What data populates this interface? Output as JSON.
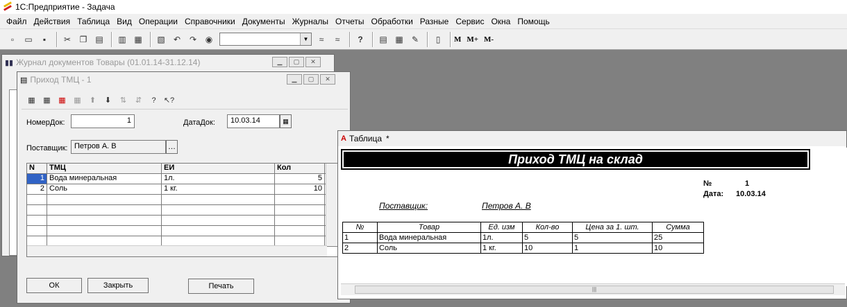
{
  "app": {
    "title": "1С:Предприятие - Задача"
  },
  "menu": [
    "Файл",
    "Действия",
    "Таблица",
    "Вид",
    "Операции",
    "Справочники",
    "Документы",
    "Журналы",
    "Отчеты",
    "Обработки",
    "Разные",
    "Сервис",
    "Окна",
    "Помощь"
  ],
  "toolbar": {
    "memory": [
      "M",
      "M+",
      "M-"
    ]
  },
  "journal_window": {
    "title": "Журнал документов  Товары (01.01.14-31.12.14)"
  },
  "form_window": {
    "title": "Приход ТМЦ - 1",
    "nomer_label": "НомерДок:",
    "nomer_value": "1",
    "date_label": "ДатаДок:",
    "date_value": "10.03.14",
    "supplier_label": "Поставщик:",
    "supplier_value": "Петров А. В",
    "grid": {
      "columns": [
        "N",
        "ТМЦ",
        "ЕИ",
        "Кол"
      ],
      "rows": [
        {
          "n": "1",
          "item": "Вода минеральная",
          "unit": "1л.",
          "qty": "5"
        },
        {
          "n": "2",
          "item": "Соль",
          "unit": "1 кг.",
          "qty": "10"
        }
      ]
    },
    "buttons": {
      "ok": "ОК",
      "close": "Закрыть",
      "print": "Печать"
    }
  },
  "table_window": {
    "title": "Таблица",
    "modified_mark": "*",
    "report_title": "Приход ТМЦ на склад",
    "number_label": "№",
    "number_value": "1",
    "date_label": "Дата:",
    "date_value": "10.03.14",
    "supplier_label": "Поставщик:",
    "supplier_value": "Петров А. В",
    "table": {
      "columns": [
        "№",
        "Товар",
        "Ед. изм",
        "Кол-во",
        "Цена за 1. шт.",
        "Сумма"
      ],
      "rows": [
        [
          "1",
          "Вода минеральная",
          "1л.",
          "5",
          "5",
          "25"
        ],
        [
          "2",
          "Соль",
          "1 кг.",
          "10",
          "1",
          "10"
        ]
      ]
    }
  }
}
